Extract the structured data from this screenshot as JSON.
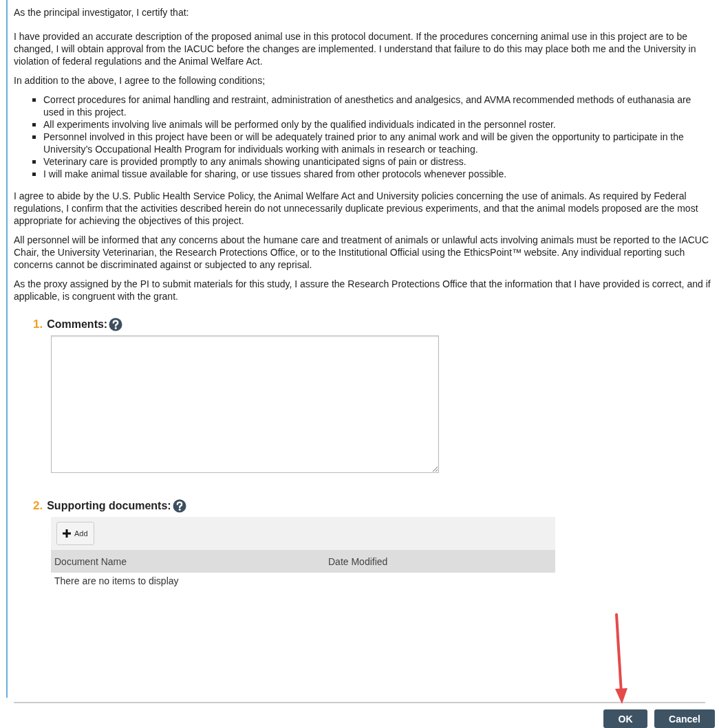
{
  "body": [
    {
      "kind": "paragraph",
      "text": "As the principal investigator, I certify that:"
    },
    {
      "kind": "paragraph",
      "text": "I have provided an accurate description of the proposed animal use in this protocol document. If the procedures concerning animal use in this project are to be changed, I will obtain approval from the IACUC before the changes are implemented.  I understand that failure to do this may place both me and the University in violation of federal regulations and the Animal Welfare Act."
    },
    {
      "kind": "paragraph",
      "text": "In addition to the above, I agree to the following conditions;"
    },
    {
      "kind": "list",
      "items": [
        "Correct procedures for animal handling and restraint, administration of anesthetics and analgesics, and AVMA recommended methods of euthanasia are used in this project.",
        "All experiments involving live animals will be performed only by the qualified individuals indicated in the personnel roster.",
        "Personnel involved in this project have been or will be adequately trained prior to any animal work and will be given the opportunity to participate in the University’s Occupational Health Program for individuals working with animals in research or teaching.",
        "Veterinary care is provided promptly to any animals showing unanticipated signs of pain or distress.",
        "I will make animal tissue available for sharing, or use tissues shared from other protocols whenever possible."
      ]
    },
    {
      "kind": "paragraph",
      "text": "I agree to abide by the U.S. Public Health Service Policy, the Animal Welfare Act and University policies concerning the use of animals.  As required by Federal regulations, I confirm that the activities described herein do not unnecessarily duplicate previous experiments, and that the animal models proposed are the most appropriate for achieving the objectives of this project."
    },
    {
      "kind": "paragraph",
      "text": "All personnel will be informed that any concerns about the humane care and treatment of animals or unlawful acts involving animals must be reported to the IACUC Chair, the University Veterinarian, the Research Protections Office, or to the Institutional Official using the EthicsPoint™ website. Any individual reporting such concerns cannot be discriminated against or subjected to any reprisal."
    },
    {
      "kind": "paragraph",
      "text": "As the proxy assigned by the PI to submit materials for this study, I assure the Research Protections Office that the information that I have provided is correct, and if applicable, is congruent with the grant."
    }
  ],
  "questions": [
    {
      "number": "1.",
      "label": "Comments:",
      "kind": "textarea"
    },
    {
      "number": "2.",
      "label": "Supporting documents:",
      "kind": "documents",
      "add_button": "Add",
      "columns": [
        "Document Name",
        "Date Modified"
      ],
      "empty_message": "There are no items to display"
    }
  ],
  "buttons": [
    {
      "label": "OK"
    },
    {
      "label": "Cancel"
    }
  ]
}
